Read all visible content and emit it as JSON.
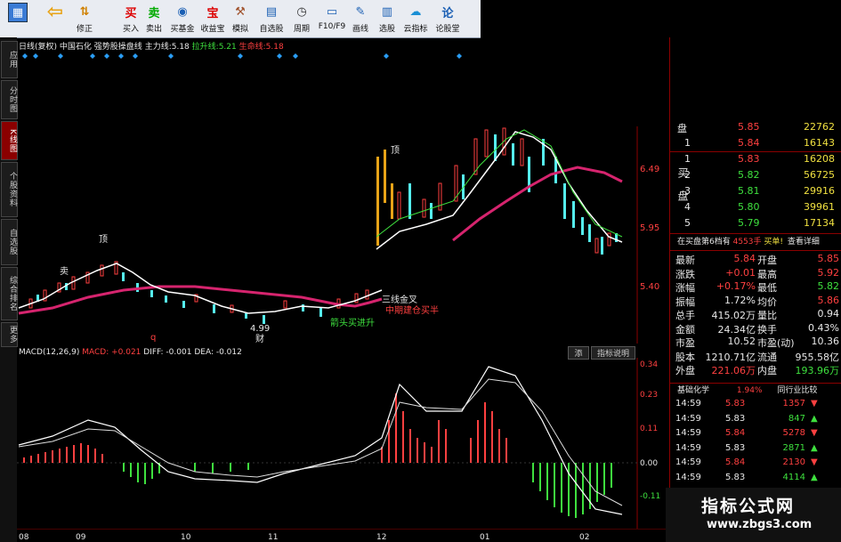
{
  "toolbar": {
    "buttons": [
      {
        "label": "",
        "icon": "grid-icon"
      },
      {
        "label": "",
        "icon": "back-icon"
      },
      {
        "label": "修正",
        "icon": "updown-icon"
      },
      {
        "label": "买入",
        "icon": "buy-icon",
        "glyph": "买"
      },
      {
        "label": "卖出",
        "icon": "sell-icon",
        "glyph": "卖"
      },
      {
        "label": "买基金",
        "icon": "fund-icon"
      },
      {
        "label": "收益宝",
        "icon": "bao-icon",
        "glyph": "宝"
      },
      {
        "label": "模拟",
        "icon": "hammer-icon"
      },
      {
        "label": "自选股",
        "icon": "watchlist-icon"
      },
      {
        "label": "周期",
        "icon": "clock-icon"
      },
      {
        "label": "F10/F9",
        "icon": "f10-icon"
      },
      {
        "label": "画线",
        "icon": "pencil-icon"
      },
      {
        "label": "选股",
        "icon": "select-icon"
      },
      {
        "label": "云指标",
        "icon": "cloud-icon"
      },
      {
        "label": "论股堂",
        "icon": "forum-icon",
        "glyph": "论"
      }
    ]
  },
  "left_tabs": [
    "应用",
    "分时图",
    "K线图",
    "个股资料",
    "自选股",
    "综合排名",
    "更多"
  ],
  "chart_header": {
    "period": "日线(复权)",
    "stock": "中国石化",
    "indicator": "强势股操盘线",
    "main_line_label": "主力线:",
    "main_line_value": "5.18",
    "rise_line_label": "拉升线:",
    "rise_line_value": "5.21",
    "life_line_label": "生命线:",
    "life_line_value": "5.18"
  },
  "price_axis": [
    "6.49",
    "5.95",
    "5.40"
  ],
  "annotations": {
    "top_left": "顶",
    "top_right": "顶",
    "sell": "卖",
    "low_value": "4.99",
    "cai": "财",
    "q": "q",
    "buy1": "三线金叉",
    "buy2": "中期建仓买半",
    "buy3": "箭头买进升"
  },
  "macd_header": {
    "title": "MACD(12,26,9)",
    "macd": "MACD: +0.021",
    "diff": "DIFF: -0.001",
    "dea": "DEA: -0.012",
    "btn1": "添",
    "btn2": "指标说明"
  },
  "macd_axis": [
    "0.34",
    "0.23",
    "0.11",
    "0.00",
    "-0.11"
  ],
  "x_axis": [
    "08",
    "09",
    "10",
    "11",
    "12",
    "01",
    "02"
  ],
  "order_book": {
    "sell": [
      {
        "level": "盘",
        "price": "5.85",
        "vol": "22762"
      },
      {
        "level": "1",
        "price": "5.84",
        "vol": "16143"
      }
    ],
    "buy_side_label": "买盘",
    "buy": [
      {
        "level": "1",
        "price": "5.83",
        "vol": "16208"
      },
      {
        "level": "2",
        "price": "5.82",
        "vol": "56725"
      },
      {
        "level": "3",
        "price": "5.81",
        "vol": "29916"
      },
      {
        "level": "4",
        "price": "5.80",
        "vol": "39961"
      },
      {
        "level": "5",
        "price": "5.79",
        "vol": "17134"
      }
    ]
  },
  "depth_notice": {
    "text": "在买盘第6档有",
    "vol": "4553手",
    "action": "买单!",
    "link": "查看详细"
  },
  "quote": [
    {
      "k1": "最新",
      "v1": "5.84",
      "k2": "开盘",
      "v2": "5.85",
      "c1": "red",
      "c2": "red"
    },
    {
      "k1": "涨跌",
      "v1": "+0.01",
      "k2": "最高",
      "v2": "5.92",
      "c1": "red",
      "c2": "red"
    },
    {
      "k1": "涨幅",
      "v1": "+0.17%",
      "k2": "最低",
      "v2": "5.82",
      "c1": "red",
      "c2": "grn"
    },
    {
      "k1": "振幅",
      "v1": "1.72%",
      "k2": "均价",
      "v2": "5.86",
      "c1": "wht",
      "c2": "red"
    },
    {
      "k1": "总手",
      "v1": "415.02万",
      "k2": "量比",
      "v2": "0.94",
      "c1": "wht",
      "c2": "wht"
    },
    {
      "k1": "金额",
      "v1": "24.34亿",
      "k2": "换手",
      "v2": "0.43%",
      "c1": "wht",
      "c2": "wht"
    },
    {
      "k1": "市盈",
      "v1": "10.52",
      "k2": "市盈(动)",
      "v2": "10.36",
      "c1": "wht",
      "c2": "wht"
    },
    {
      "k1": "股本",
      "v1": "1210.71亿",
      "k2": "流通",
      "v2": "955.58亿",
      "c1": "wht",
      "c2": "wht"
    },
    {
      "k1": "外盘",
      "v1": "221.06万",
      "k2": "内盘",
      "v2": "193.96万",
      "c1": "red",
      "c2": "grn"
    }
  ],
  "sector": {
    "name": "基础化学",
    "change": "1.94%",
    "link": "同行业比较"
  },
  "trades": [
    {
      "time": "14:59",
      "price": "5.83",
      "vol": "1357",
      "dir": "down",
      "c": "red"
    },
    {
      "time": "14:59",
      "price": "5.83",
      "vol": "847",
      "dir": "up",
      "c": "grn"
    },
    {
      "time": "14:59",
      "price": "5.84",
      "vol": "5278",
      "dir": "down",
      "c": "red"
    },
    {
      "time": "14:59",
      "price": "5.83",
      "vol": "2871",
      "dir": "up",
      "c": "grn"
    },
    {
      "time": "14:59",
      "price": "5.84",
      "vol": "2130",
      "dir": "down",
      "c": "red"
    },
    {
      "time": "14:59",
      "price": "5.83",
      "vol": "4114",
      "dir": "up",
      "c": "grn"
    }
  ],
  "watermark": {
    "title": "指标公式网",
    "url": "www.zbgs3.com"
  },
  "colors": {
    "up": "#ff4040",
    "down": "#3ee03e",
    "life_line": "#d6246e",
    "axis": "#8b0000"
  }
}
